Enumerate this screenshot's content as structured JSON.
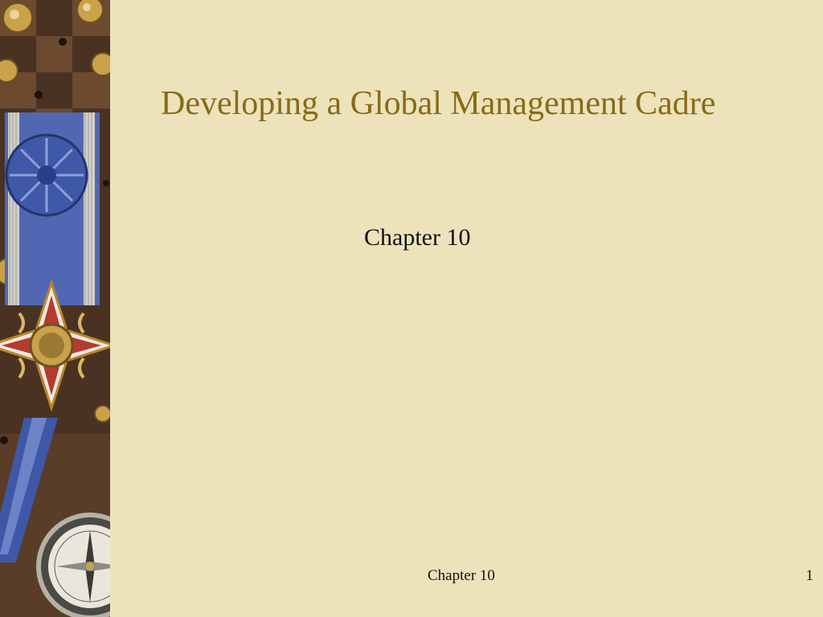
{
  "slide": {
    "title": "Developing a Global Management Cadre",
    "subtitle": "Chapter 10",
    "footer": "Chapter 10",
    "page_number": "1"
  },
  "art": {
    "description_icon": "medal-collage-image"
  },
  "colors": {
    "background": "#ece3bb",
    "title": "#8a6a17",
    "text": "#111111"
  }
}
